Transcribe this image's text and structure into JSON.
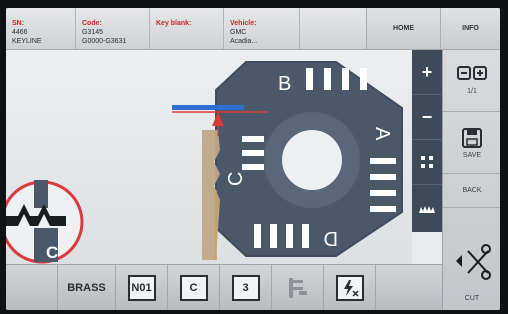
{
  "header": {
    "sn_key": "SN:",
    "sn_line1": "4466",
    "sn_line2": "KEYLINE",
    "code_key": "Code:",
    "code_line1": "G3145",
    "code_line2": "G0000-G3631",
    "keyblank_key": "Key blank:",
    "vehicle_key": "Vehicle:",
    "vehicle_line1": "GMC",
    "vehicle_line2": "Acadia...",
    "home_label": "HOME",
    "info_label": "INFO"
  },
  "workarea": {
    "side_letters": {
      "top": "B",
      "right": "A",
      "bottom": "D",
      "left": "C"
    },
    "profile_letter": "C"
  },
  "zoom": {
    "zoom_in": "+",
    "zoom_out": "−"
  },
  "right_panel": {
    "page_indicator": "1/1",
    "save_label": "SAVE",
    "back_label": "BACK",
    "cut_label": "CUT"
  },
  "bottom_bar": {
    "material": "BRASS",
    "tool_1": "N01",
    "tool_2": "C",
    "tool_3": "3"
  },
  "colors": {
    "accent_red": "#d93a3a",
    "wheel_dark": "#4b586a",
    "key_tan": "#bfa888",
    "indicator_blue": "#2f6dd0"
  }
}
